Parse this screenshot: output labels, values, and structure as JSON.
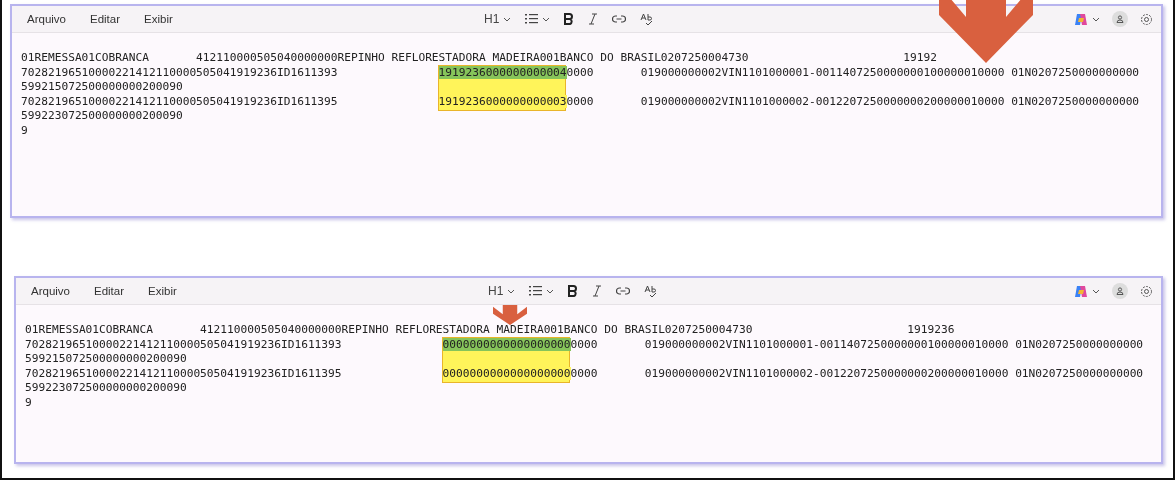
{
  "windows": [
    {
      "menu": [
        "Arquivo",
        "Editar",
        "Exibir"
      ],
      "toolbar": {
        "heading": "H1"
      },
      "lines": [
        [
          {
            "text": "01REMESSA01COBRANCA       412110000505040000000REPINHO REFLORESTADORA MADEIRA001BANCO DO BRASIL0207250004730                       19192",
            "arrow": true
          }
        ],
        [
          {
            "text": "70282196510000221412110000505041919236ID1611393               "
          },
          {
            "text": "1919236000000000004",
            "color": "#86c45a"
          },
          {
            "text": "0000       019000000002VIN1101000001-0011407250000000100000010000 01N0207250000000000"
          }
        ],
        [
          {
            "text": "599215072500000000200090"
          }
        ],
        [
          {
            "text": "70282196510000221412110000505041919236ID1611395               "
          },
          {
            "text": "1919236000000000003",
            "color": "#fff45a"
          },
          {
            "text": "0000       019000000002VIN1101000002-0012207250000000200000010000 01N0207250000000000"
          }
        ],
        [
          {
            "text": "599223072500000000200090"
          }
        ],
        [
          {
            "text": "9"
          }
        ]
      ]
    },
    {
      "menu": [
        "Arquivo",
        "Editar",
        "Exibir"
      ],
      "toolbar": {
        "heading": "H1"
      },
      "lines": [
        [
          {
            "text": "01REMESSA01COBRANCA       412110000505040000000REPINHO REFLORESTADORA MA",
            "arrow": true
          },
          {
            "text": "DEIRA001BANCO DO BRASIL0207250004730                       1919236"
          }
        ],
        [
          {
            "text": "70282196510000221412110000505041919236ID1611393               "
          },
          {
            "text": "0000000000000000000",
            "color": "#86c45a"
          },
          {
            "text": "0000       019000000002VIN1101000001-0011407250000000100000010000 01N0207250000000000"
          }
        ],
        [
          {
            "text": "599215072500000000200090"
          }
        ],
        [
          {
            "text": "70282196510000221412110000505041919236ID1611395               "
          },
          {
            "text": "0000000000000000000",
            "color": "#fff45a"
          },
          {
            "text": "0000       019000000002VIN1101000002-0012207250000000200000010000 01N0207250000000000"
          }
        ],
        [
          {
            "text": "599223072500000000200090"
          }
        ],
        [
          {
            "text": "9"
          }
        ]
      ]
    }
  ]
}
